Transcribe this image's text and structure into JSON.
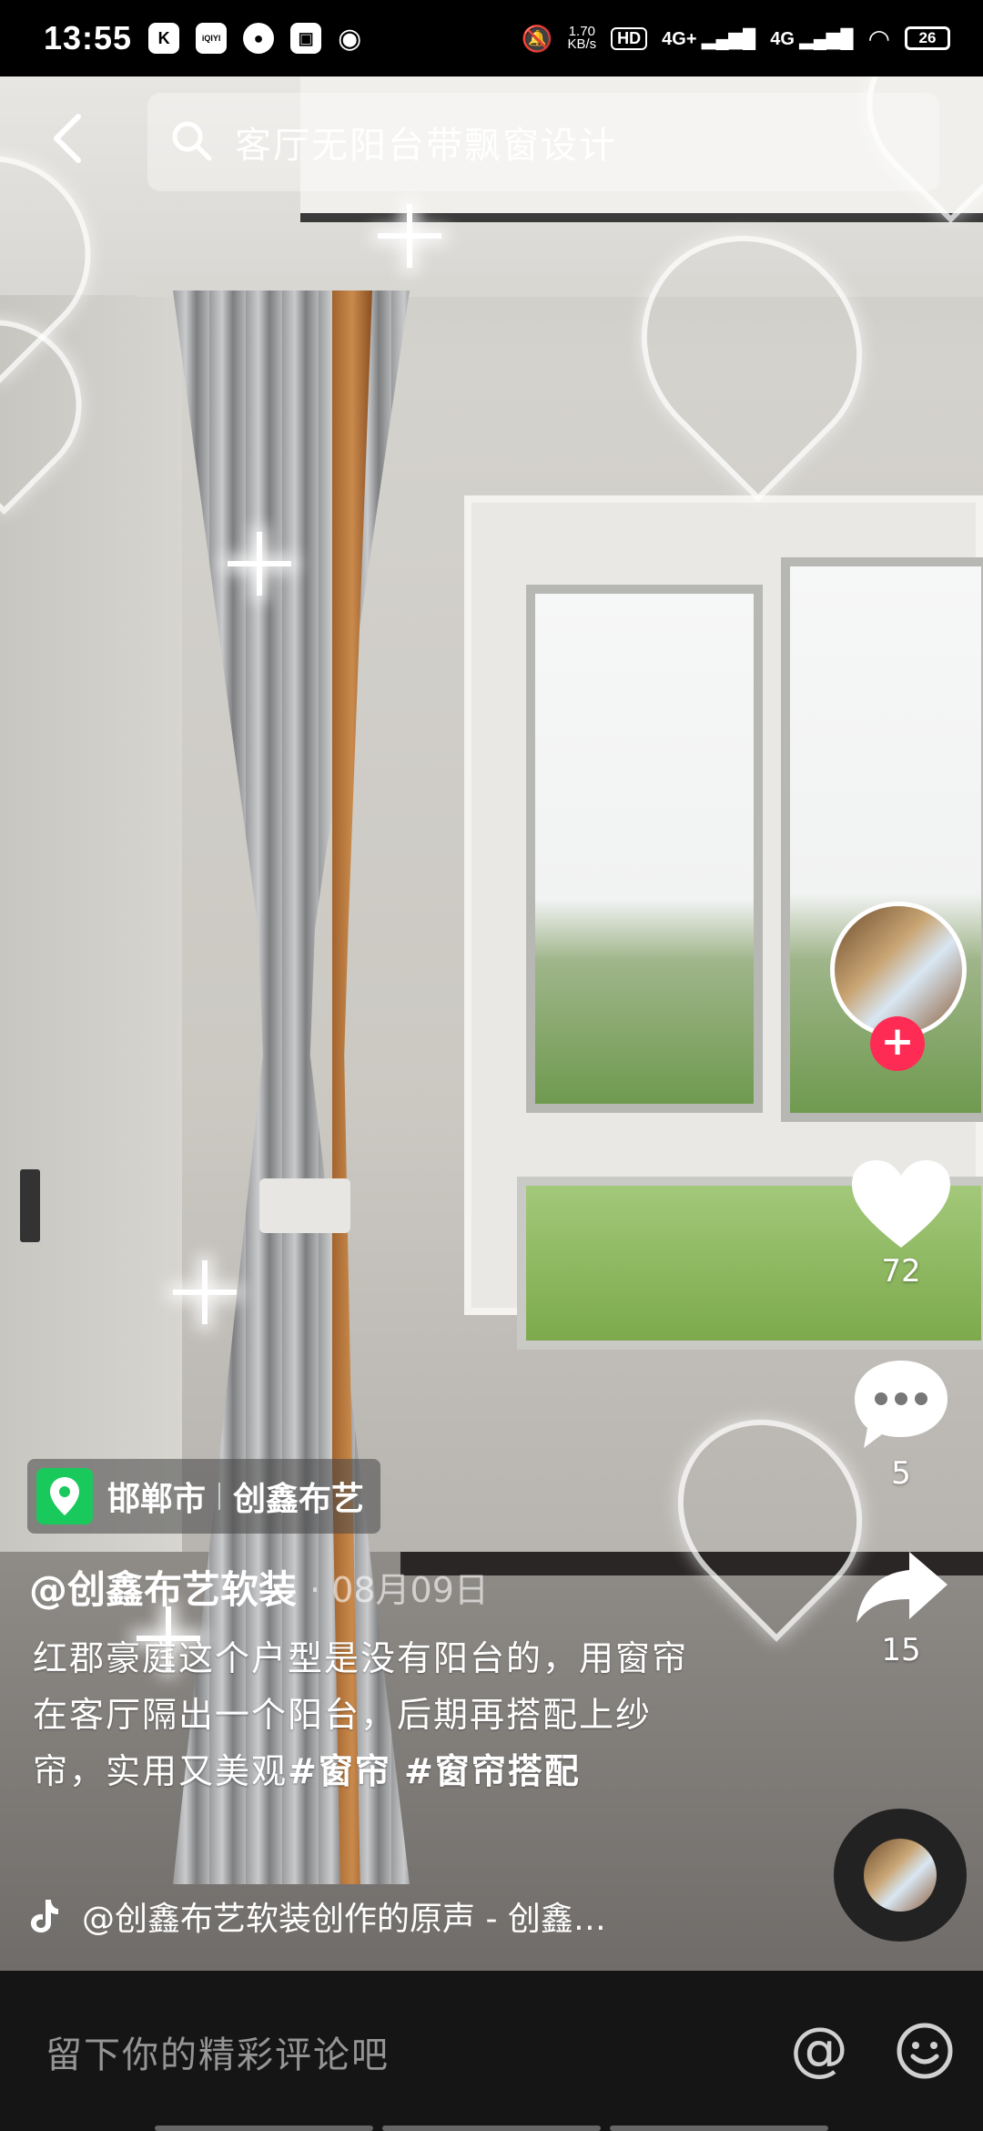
{
  "status_bar": {
    "time": "13:55",
    "app_icons": [
      "K",
      "iQIYI"
    ],
    "net_speed_value": "1.70",
    "net_speed_unit": "KB/s",
    "hd_label": "HD",
    "signal_1": "4G+",
    "signal_2": "4G",
    "battery": "26"
  },
  "search": {
    "query": "客厅无阳台带飘窗设计"
  },
  "rail": {
    "likes": "72",
    "comments": "5",
    "shares": "15"
  },
  "location": {
    "city": "邯郸市",
    "shop": "创鑫布艺"
  },
  "post": {
    "author": "@创鑫布艺软装",
    "date": "· 08月09日",
    "caption": "红郡豪庭这个户型是没有阳台的，用窗帘在客厅隔出一个阳台，后期再搭配上纱帘，实用又美观",
    "hashtag_1": "#窗帘",
    "hashtag_2": "#窗帘搭配",
    "music": "@创鑫布艺软装创作的原声 - 创鑫…"
  },
  "comment_bar": {
    "placeholder": "留下你的精彩评论吧",
    "at_symbol": "@"
  },
  "colors": {
    "accent_red": "#fe2c55",
    "location_green": "#19c95c"
  }
}
